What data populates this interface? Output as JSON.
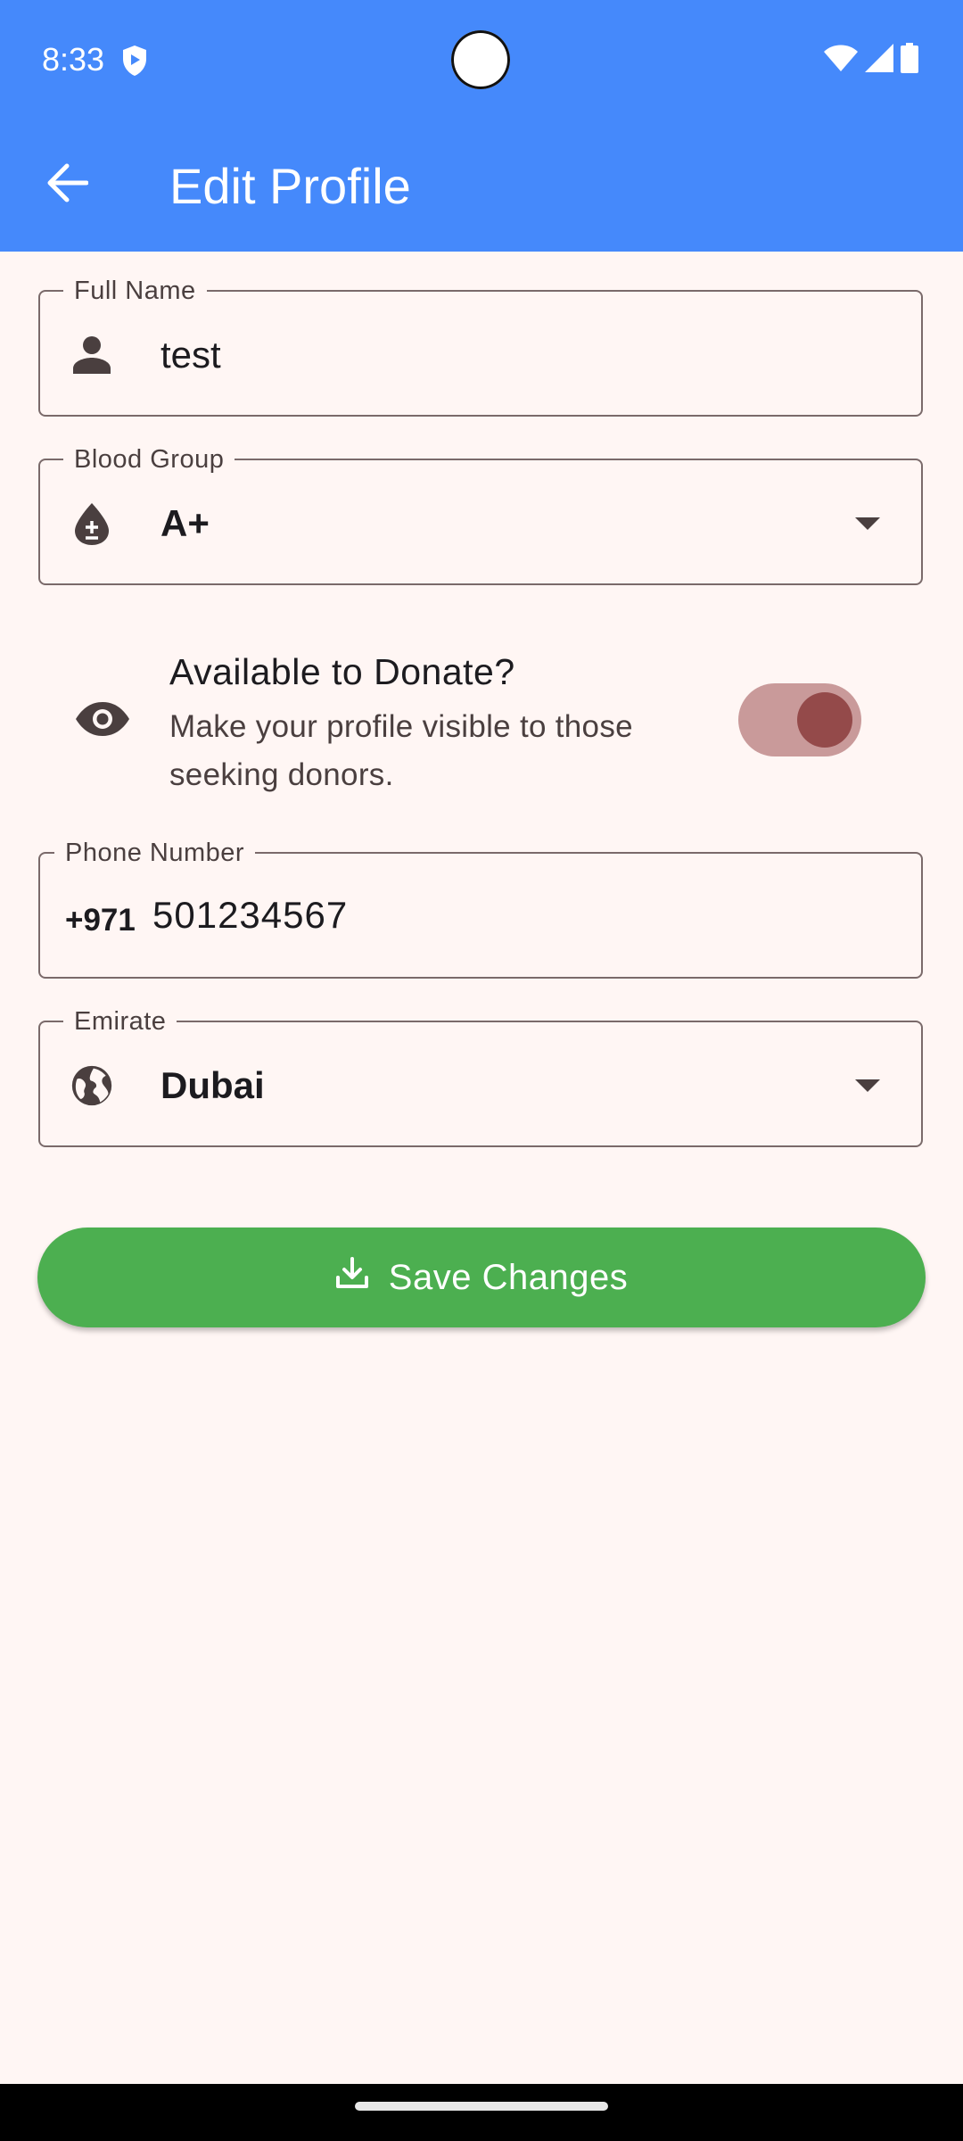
{
  "status_bar": {
    "time": "8:33",
    "icons": [
      "shield-icon",
      "wifi-icon",
      "signal-icon",
      "battery-icon"
    ]
  },
  "app_bar": {
    "title": "Edit Profile",
    "back_icon": "arrow-back-icon",
    "color": "#4589FB"
  },
  "form": {
    "full_name": {
      "label": "Full Name",
      "value": "test",
      "icon": "person-icon"
    },
    "blood_group": {
      "label": "Blood Group",
      "value": "A+",
      "icon": "blood-drop-icon"
    },
    "donate": {
      "title": "Available to Donate?",
      "subtitle": "Make your profile visible to those seeking donors.",
      "icon": "eye-icon",
      "enabled": true
    },
    "phone": {
      "label": "Phone Number",
      "prefix": "+971",
      "value": "501234567"
    },
    "emirate": {
      "label": "Emirate",
      "value": "Dubai",
      "icon": "globe-icon"
    }
  },
  "save_button": {
    "label": "Save Changes",
    "icon": "download-icon",
    "color": "#4CAF50"
  },
  "colors": {
    "background": "#FFF6F4",
    "toggle_track": "#C99A9A",
    "toggle_thumb": "#944A4A",
    "icon": "#4a3f3f"
  }
}
